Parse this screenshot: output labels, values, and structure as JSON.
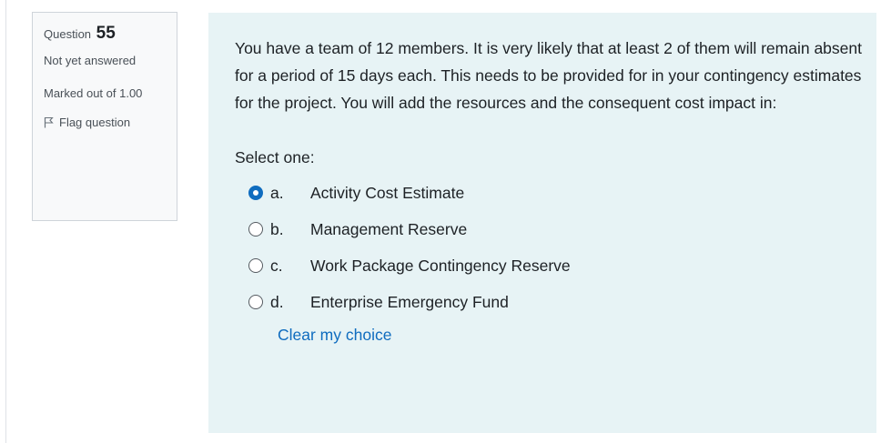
{
  "info": {
    "question_label": "Question",
    "question_number": "55",
    "state": "Not yet answered",
    "grade": "Marked out of 1.00",
    "flag_label": "Flag question"
  },
  "question": {
    "text": "You have a team of 12 members. It is very likely that at least 2 of them will remain absent for a period of 15 days each. This needs to be provided for in your contingency estimates for the project. You will add the resources and the consequent cost impact in:",
    "prompt": "Select one:",
    "options": [
      {
        "letter": "a.",
        "label": "Activity Cost Estimate",
        "selected": true
      },
      {
        "letter": "b.",
        "label": "Management Reserve",
        "selected": false
      },
      {
        "letter": "c.",
        "label": "Work Package Contingency Reserve",
        "selected": false
      },
      {
        "letter": "d.",
        "label": "Enterprise Emergency Fund",
        "selected": false
      }
    ],
    "clear_label": "Clear my choice"
  },
  "colors": {
    "content_background": "#e7f3f5",
    "info_background": "#f8f9fa",
    "accent": "#0f6cbf"
  },
  "icons": {
    "flag": "flag-icon"
  }
}
